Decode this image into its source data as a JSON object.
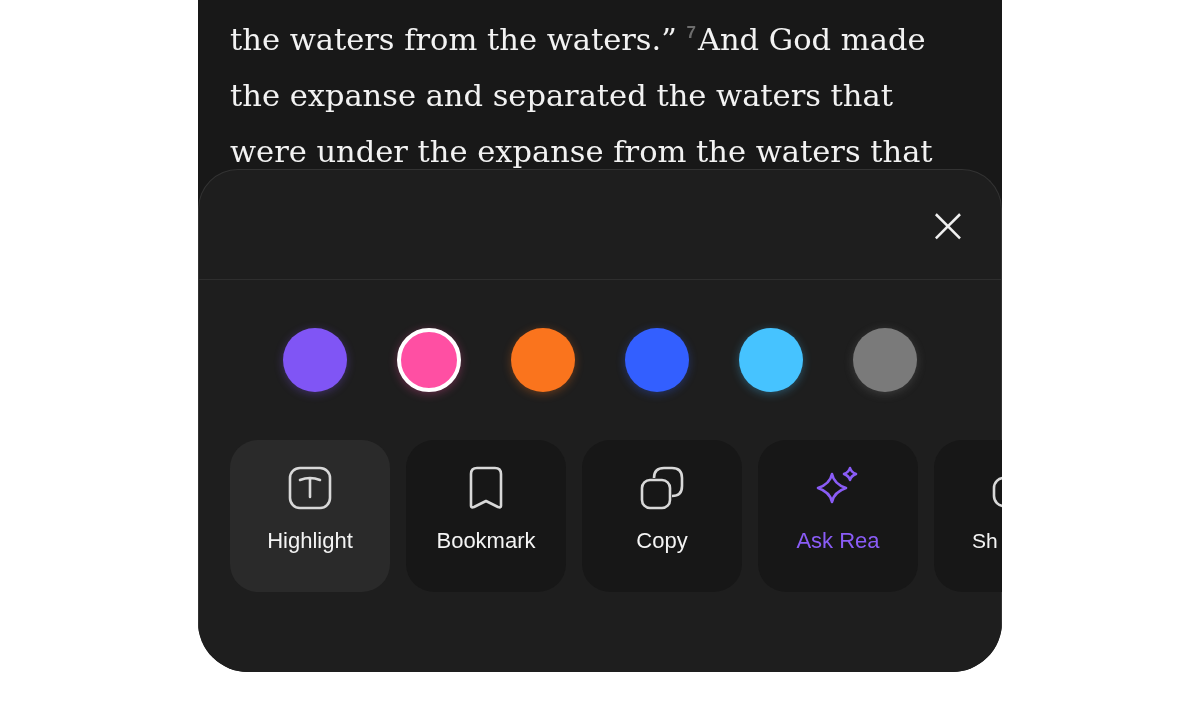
{
  "passage": {
    "lines": [
      "the waters from the waters.” $^{7}$And God made",
      "the expanse and separated the waters that",
      "were under the expanse from the waters that"
    ]
  },
  "sheet": {
    "close_label": "×",
    "colors": [
      {
        "color": "#8055f5",
        "selected": false
      },
      {
        "color": "#ff4fa3",
        "selected": true
      },
      {
        "color": "#fa741d",
        "selected": false
      },
      {
        "color": "#335fff",
        "selected": false
      },
      {
        "color": "#46c3ff",
        "selected": false
      },
      {
        "color": "#7a7a7a",
        "selected": false
      }
    ],
    "actions": [
      {
        "kind": "highlight",
        "label": "Highlight",
        "selected": true
      },
      {
        "kind": "bookmark",
        "label": "Bookmark",
        "selected": false
      },
      {
        "kind": "copy",
        "label": "Copy",
        "selected": false
      },
      {
        "kind": "ask",
        "label": "Ask Rea",
        "selected": false
      },
      {
        "kind": "share",
        "label": "Sh",
        "selected": false
      }
    ]
  }
}
